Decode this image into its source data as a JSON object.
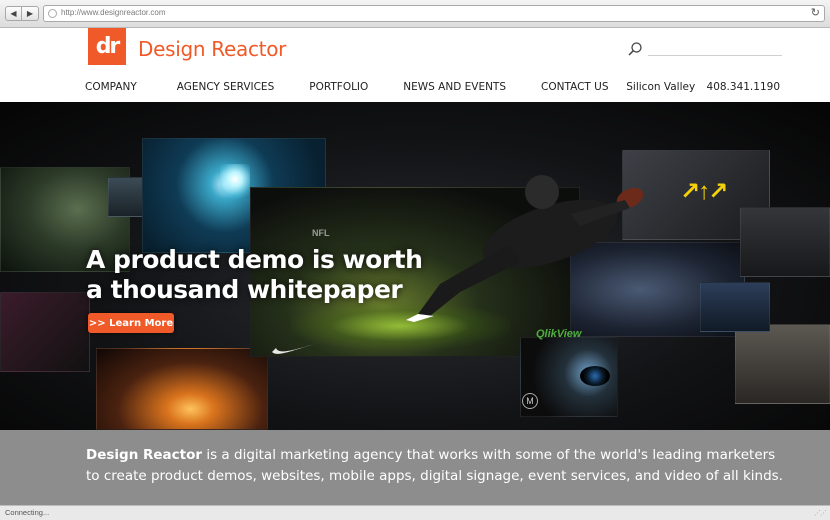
{
  "browser": {
    "url": "http://www.designreactor.com",
    "back_glyph": "◀",
    "forward_glyph": "▶",
    "reload_glyph": "↻",
    "status": "Connecting..."
  },
  "header": {
    "logo_mark": "dr",
    "logo_text": "Design Reactor",
    "brand_color": "#f05a28",
    "search_icon": "search-icon",
    "nav": [
      "COMPANY",
      "AGENCY SERVICES",
      "PORTFOLIO",
      "NEWS AND EVENTS",
      "CONTACT US"
    ],
    "location": "Silicon Valley",
    "phone": "408.341.1190"
  },
  "hero": {
    "headline": "A product demo is worth a thousand whitepaper",
    "cta": ">> Learn More",
    "logos": {
      "nfl": "NFL",
      "qlik": "QlikView",
      "motorola": "M"
    }
  },
  "description": {
    "brand": "Design Reactor",
    "text": " is a digital marketing agency that works with some of the world's leading marketers to create product demos, websites, mobile apps, digital signage, event services, and video of all kinds."
  }
}
